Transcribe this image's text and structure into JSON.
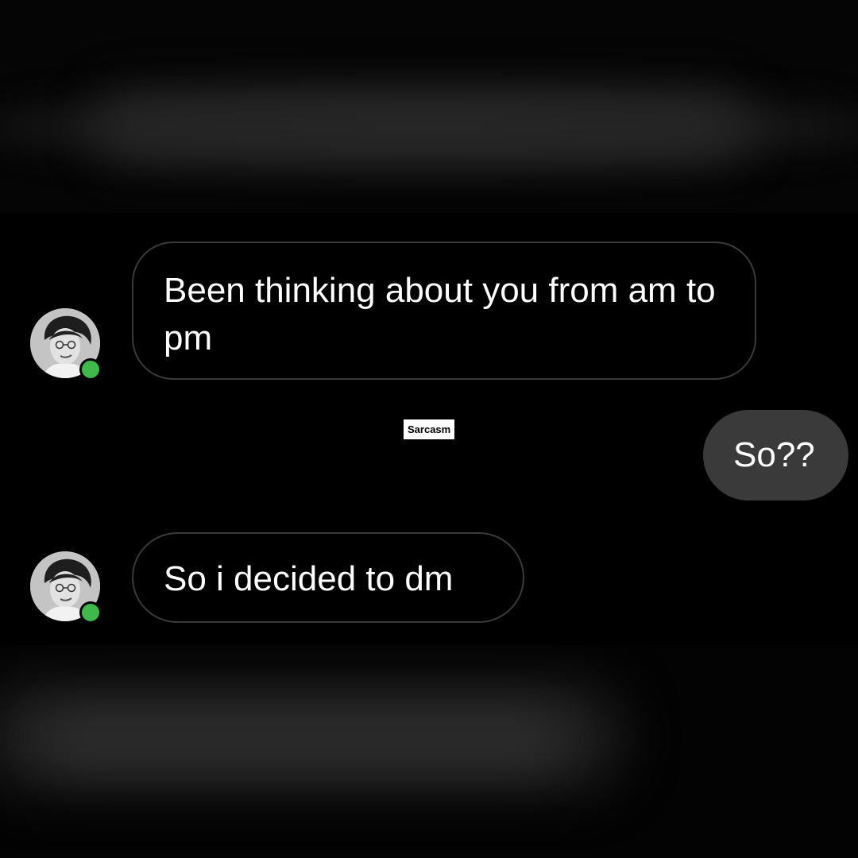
{
  "messages": [
    {
      "sender": "them",
      "text": "Been thinking about you from am to pm"
    },
    {
      "sender": "me",
      "text": "So??"
    },
    {
      "sender": "them",
      "text": "So i decided to dm"
    }
  ],
  "watermark": "Sarcasm",
  "status": {
    "online_color": "#3fb94a"
  },
  "colors": {
    "background": "#000000",
    "incoming_bubble_border": "#3a3a3a",
    "outgoing_bubble_fill": "#3a3a3a",
    "text": "#ffffff"
  },
  "icons": [
    "avatar-photo",
    "online-status-dot"
  ]
}
